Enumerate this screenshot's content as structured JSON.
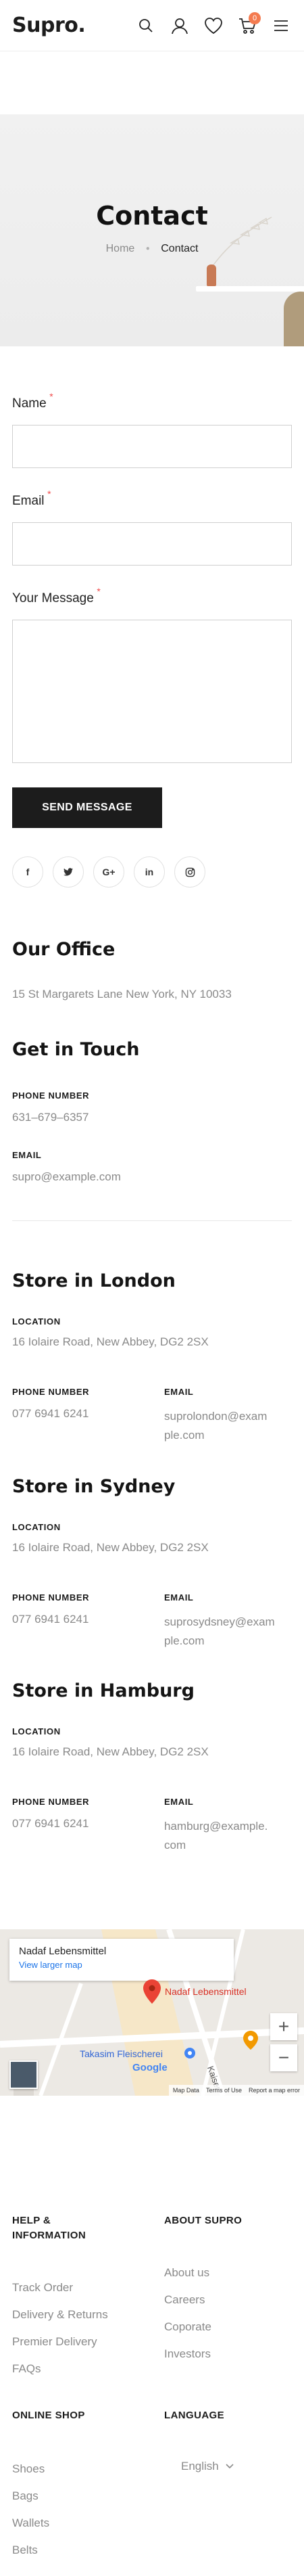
{
  "header": {
    "logo": "Supro.",
    "cart_count": "0"
  },
  "banner": {
    "title": "Contact",
    "breadcrumb_home": "Home",
    "breadcrumb_current": "Contact"
  },
  "form": {
    "name_label": "Name",
    "email_label": "Email",
    "message_label": "Your Message",
    "required_mark": "*",
    "submit_label": "Send Message"
  },
  "socials": [
    {
      "icon": "facebook-icon",
      "glyph": "f"
    },
    {
      "icon": "twitter-icon",
      "glyph": "🐦"
    },
    {
      "icon": "google-plus-icon",
      "glyph": "G+"
    },
    {
      "icon": "linkedin-icon",
      "glyph": "in"
    },
    {
      "icon": "instagram-icon",
      "glyph": "◎"
    }
  ],
  "office": {
    "title": "Our Office",
    "address": "15 St Margarets Lane New York, NY 10033"
  },
  "get_in_touch": {
    "title": "Get in Touch",
    "phone_label": "PHONE NUMBER",
    "phone": "631–679–6357",
    "email_label": "EMAIL",
    "email": "supro@example.com"
  },
  "stores": [
    {
      "title": "Store in London",
      "location_label": "LOCATION",
      "location": "16 Iolaire Road, New Abbey, DG2 2SX",
      "phone_label": "PHONE NUMBER",
      "phone": "077 6941 6241",
      "email_label": "EMAIL",
      "email_line1": "suprolondon@exam",
      "email_line2": "ple.com"
    },
    {
      "title": "Store in Sydney",
      "location_label": "LOCATION",
      "location": "16 Iolaire Road, New Abbey, DG2 2SX",
      "phone_label": "PHONE NUMBER",
      "phone": "077 6941 6241",
      "email_label": "EMAIL",
      "email_line1": "suprosydsney@exam",
      "email_line2": "ple.com"
    },
    {
      "title": "Store in Hamburg",
      "location_label": "LOCATION",
      "location": "16 Iolaire Road, New Abbey, DG2 2SX",
      "phone_label": "PHONE NUMBER",
      "phone": "077 6941 6241",
      "email_label": "EMAIL",
      "email_line1": "hamburg@example.",
      "email_line2": "com"
    }
  ],
  "map": {
    "place_name": "Nadaf Lebensmittel",
    "view_larger": "View larger map",
    "pin_label": "Nadaf Lebensmittel",
    "poi_label": "Takasim Fleischerei",
    "street_label": "Kaiser",
    "google": "Google",
    "zoom_in": "+",
    "zoom_out": "−",
    "footer_items": [
      "Map Data",
      "Terms of Use",
      "Report a map error"
    ]
  },
  "footer": {
    "help_heading_line1": "HELP &",
    "help_heading_line2": "INFORMATION",
    "help_links": [
      "Track Order",
      "Delivery & Returns",
      "Premier Delivery",
      "FAQs"
    ],
    "about_heading": "ABOUT SUPRO",
    "about_links": [
      "About us",
      "Careers",
      "Coporate",
      "Investors"
    ],
    "shop_heading": "ONLINE SHOP",
    "shop_links": [
      "Shoes",
      "Bags",
      "Wallets",
      "Belts"
    ],
    "language_heading": "LANGUAGE",
    "language_value": "English"
  }
}
